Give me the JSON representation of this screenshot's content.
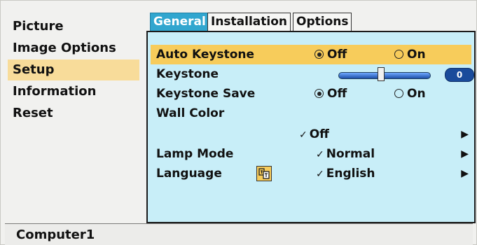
{
  "sidebar": {
    "items": [
      {
        "label": "Picture"
      },
      {
        "label": "Image Options"
      },
      {
        "label": "Setup"
      },
      {
        "label": "Information"
      },
      {
        "label": "Reset"
      }
    ]
  },
  "tabs": [
    {
      "label": "General"
    },
    {
      "label": "Installation"
    },
    {
      "label": "Options"
    }
  ],
  "settings": {
    "auto_keystone": {
      "label": "Auto Keystone",
      "off": "Off",
      "on": "On",
      "selected": "Off"
    },
    "keystone": {
      "label": "Keystone",
      "value": "0",
      "level": 0.5
    },
    "keystone_save": {
      "label": "Keystone Save",
      "off": "Off",
      "on": "On",
      "selected": "Off"
    },
    "wall_color": {
      "label": "Wall Color",
      "value": "Off"
    },
    "lamp_mode": {
      "label": "Lamp Mode",
      "value": "Normal"
    },
    "language": {
      "label": "Language",
      "value": "English"
    }
  },
  "status": {
    "source": "Computer1"
  },
  "colors": {
    "highlight": "#f7cc5b",
    "panel": "#c8eef8",
    "active_tab": "#31a6cf",
    "selected_sidebar": "#f8dc9a"
  }
}
